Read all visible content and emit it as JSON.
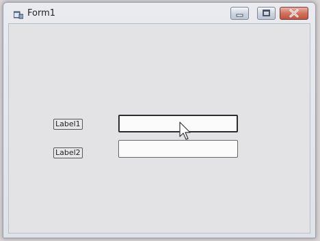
{
  "window": {
    "title": "Form1",
    "icon": "form-app-icon",
    "buttons": {
      "minimize": "minimize-icon",
      "maximize": "maximize-icon",
      "close": "close-icon"
    },
    "close_color": "#c9573f"
  },
  "form": {
    "label1": "Label1",
    "label2": "Label2",
    "textbox1_value": "",
    "textbox2_value": ""
  },
  "cursor": "arrow-cursor-icon"
}
